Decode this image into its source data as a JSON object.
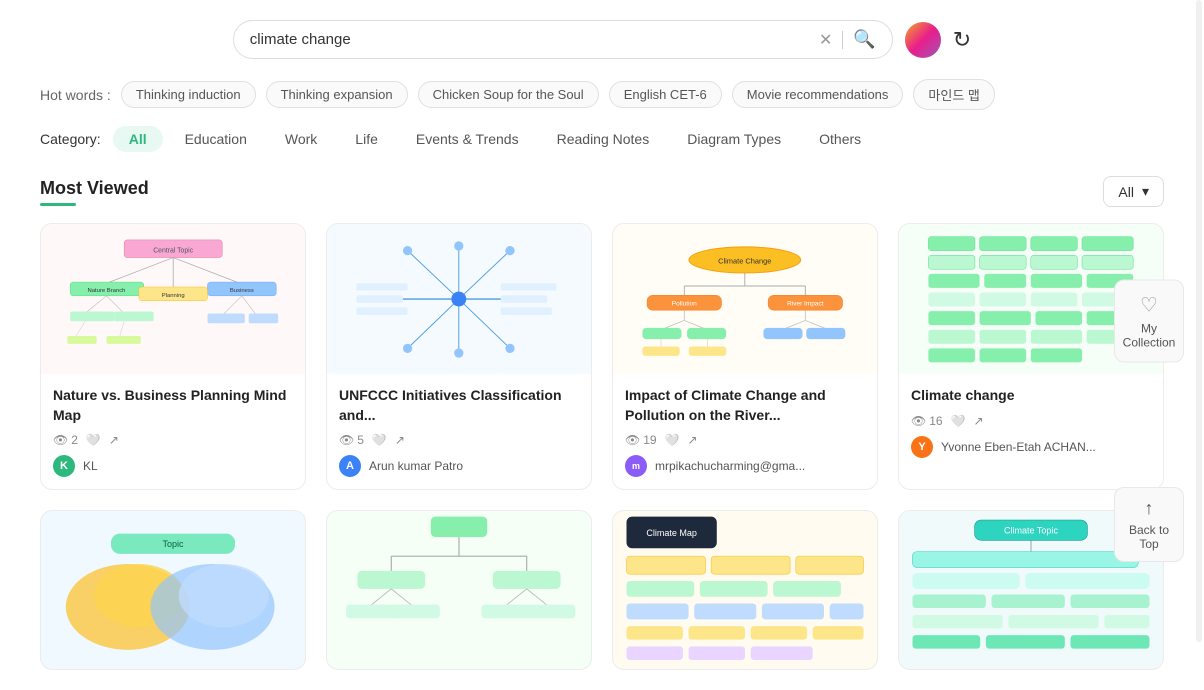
{
  "search": {
    "placeholder": "climate change",
    "value": "climate change"
  },
  "hotWords": {
    "label": "Hot words :",
    "tags": [
      "Thinking induction",
      "Thinking expansion",
      "Chicken Soup for the Soul",
      "English CET-6",
      "Movie recommendations",
      "마인드 맵"
    ]
  },
  "category": {
    "label": "Category:",
    "items": [
      "All",
      "Education",
      "Work",
      "Life",
      "Events & Trends",
      "Reading Notes",
      "Diagram Types",
      "Others"
    ],
    "active": "All"
  },
  "mostViewed": {
    "title": "Most Viewed",
    "filterLabel": "All",
    "cards": [
      {
        "title": "Nature vs. Business Planning Mind Map",
        "views": "2",
        "likes": "",
        "shares": "",
        "author": "KL",
        "authorType": "green"
      },
      {
        "title": "UNFCCC Initiatives Classification and...",
        "views": "5",
        "likes": "",
        "shares": "",
        "author": "Arun kumar Patro",
        "authorType": "blue"
      },
      {
        "title": "Impact of Climate Change and Pollution on the River...",
        "views": "19",
        "likes": "",
        "shares": "",
        "author": "mrpikachucharming@gma...",
        "authorType": "purple"
      },
      {
        "title": "Climate change",
        "views": "16",
        "likes": "",
        "shares": "",
        "author": "Yvonne Eben-Etah ACHAN...",
        "authorType": "orange"
      }
    ]
  },
  "floatingButtons": {
    "myCollection": {
      "icon": "♡",
      "label": "My Collection"
    },
    "backToTop": {
      "icon": "↑",
      "label": "Back to Top"
    }
  }
}
